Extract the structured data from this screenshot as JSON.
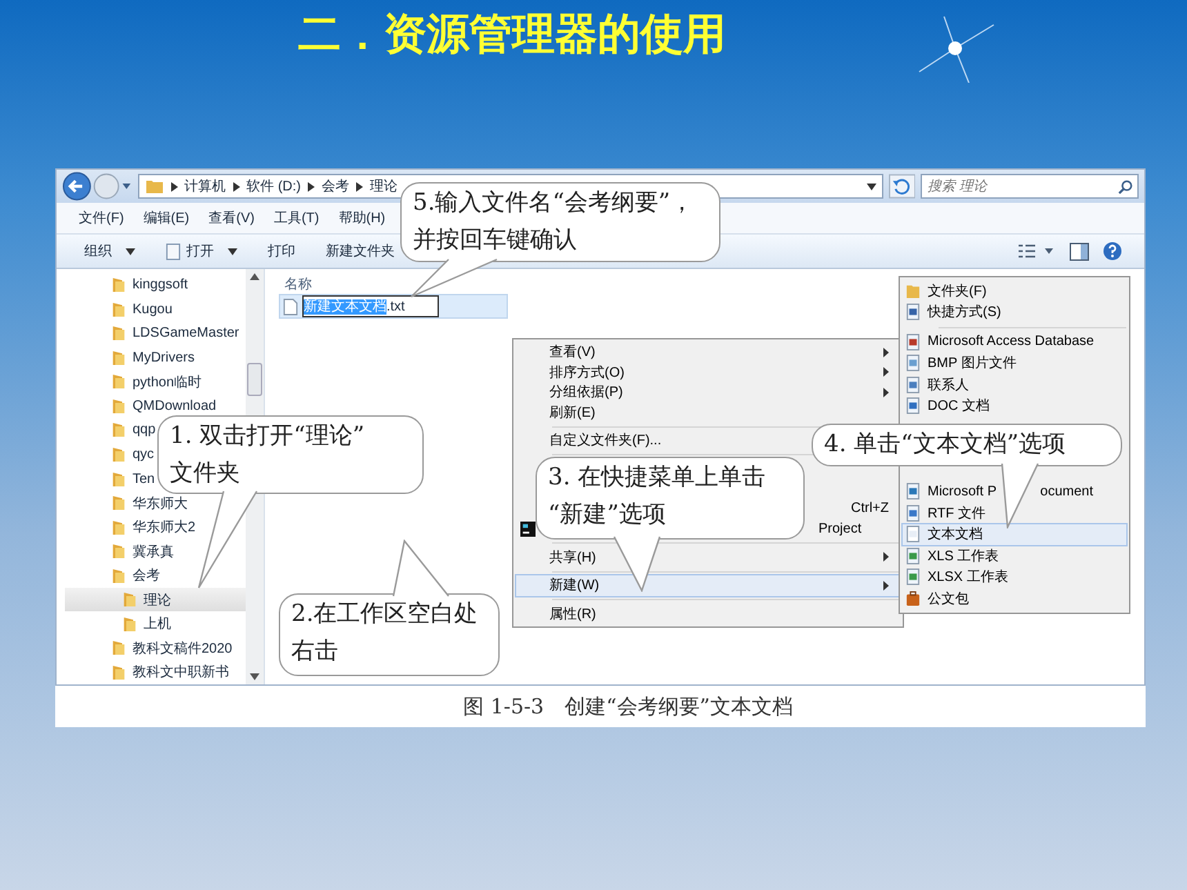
{
  "slide_title": "二．资源管理器的使用",
  "explorer": {
    "breadcrumb": [
      "计算机",
      "软件 (D:)",
      "会考",
      "理论"
    ],
    "search": {
      "placeholder": "搜索 理论"
    },
    "menu_bar": [
      "文件(F)",
      "编辑(E)",
      "查看(V)",
      "工具(T)",
      "帮助(H)"
    ],
    "toolbar": [
      {
        "label": "组织",
        "dropdown": true
      },
      {
        "label": "打开",
        "dropdown": true
      },
      {
        "label": "打印",
        "dropdown": false
      },
      {
        "label": "新建文件夹",
        "dropdown": false
      }
    ],
    "sidebar": {
      "items": [
        {
          "label": "kinggsoft",
          "selected": false
        },
        {
          "label": "Kugou",
          "selected": false
        },
        {
          "label": "LDSGameMaster",
          "selected": false
        },
        {
          "label": "MyDrivers",
          "selected": false
        },
        {
          "label": "python临时",
          "selected": false
        },
        {
          "label": "QMDownload",
          "selected": false
        },
        {
          "label": "qqp",
          "selected": false
        },
        {
          "label": "qyc",
          "selected": false
        },
        {
          "label": "Ten",
          "selected": false
        },
        {
          "label": "华东师大",
          "selected": false
        },
        {
          "label": "华东师大2",
          "selected": false
        },
        {
          "label": "冀承真",
          "selected": false
        },
        {
          "label": "会考",
          "selected": false,
          "children": [
            {
              "label": "理论",
              "selected": true
            },
            {
              "label": "上机",
              "selected": false
            }
          ]
        },
        {
          "label": "教科文稿件2020",
          "selected": false
        },
        {
          "label": "教科文中职新书",
          "selected": false
        }
      ]
    },
    "column_header": "名称",
    "rename_field": {
      "selected_text": "新建文本文档",
      "rest": ".txt"
    }
  },
  "context_menu": [
    {
      "kind": "item",
      "label": "查看(V)",
      "submenu": true,
      "selected": false
    },
    {
      "kind": "item",
      "label": "排序方式(O)",
      "submenu": true,
      "selected": false
    },
    {
      "kind": "item",
      "label": "分组依据(P)",
      "submenu": true,
      "selected": false
    },
    {
      "kind": "item",
      "label": "刷新(E)",
      "submenu": false,
      "selected": false
    },
    {
      "kind": "separator"
    },
    {
      "kind": "item",
      "label": "自定义文件夹(F)...",
      "submenu": false,
      "selected": false
    },
    {
      "kind": "separator"
    },
    {
      "kind": "covered"
    },
    {
      "kind": "covered"
    },
    {
      "kind": "covered",
      "shortcut": "Ctrl+Z"
    },
    {
      "kind": "covered",
      "icon": true,
      "fragment": "Project"
    },
    {
      "kind": "separator"
    },
    {
      "kind": "item",
      "label": "共享(H)",
      "submenu": true,
      "selected": false
    },
    {
      "kind": "separator"
    },
    {
      "kind": "item",
      "label": "新建(W)",
      "submenu": true,
      "selected": true
    },
    {
      "kind": "separator"
    },
    {
      "kind": "item",
      "label": "属性(R)",
      "submenu": false,
      "selected": false
    }
  ],
  "new_submenu": [
    {
      "kind": "item",
      "label": "文件夹(F)",
      "selected": false
    },
    {
      "kind": "item",
      "label": "快捷方式(S)",
      "selected": false
    },
    {
      "kind": "separator"
    },
    {
      "kind": "item",
      "label": "Microsoft Access Database",
      "selected": false
    },
    {
      "kind": "item",
      "label": "BMP 图片文件",
      "selected": false
    },
    {
      "kind": "item",
      "label": "联系人",
      "selected": false
    },
    {
      "kind": "item",
      "label": "DOC 文档",
      "selected": false
    },
    {
      "kind": "covered"
    },
    {
      "kind": "covered"
    },
    {
      "kind": "covered"
    },
    {
      "kind": "item",
      "label": "Microsoft P",
      "tail": "ocument",
      "selected": false
    },
    {
      "kind": "item",
      "label": "RTF 文件",
      "selected": false
    },
    {
      "kind": "item",
      "label": "文本文档",
      "selected": true
    },
    {
      "kind": "item",
      "label": "XLS 工作表",
      "selected": false
    },
    {
      "kind": "item",
      "label": "XLSX 工作表",
      "selected": false
    },
    {
      "kind": "item",
      "label": "公文包",
      "selected": false
    }
  ],
  "callouts": [
    {
      "lines": [
        "1. 双击打开“理论”",
        "文件夹"
      ]
    },
    {
      "lines": [
        "2.在工作区空白处",
        "右击"
      ]
    },
    {
      "lines": [
        "3. 在快捷菜单上单击",
        "“新建”选项"
      ]
    },
    {
      "lines": [
        "4. 单击“文本文档”选项"
      ]
    },
    {
      "lines": [
        "5.输入文件名“会考纲要”，",
        "并按回车键确认"
      ]
    }
  ],
  "caption": "图 1-5-3　创建“会考纲要”文本文档"
}
